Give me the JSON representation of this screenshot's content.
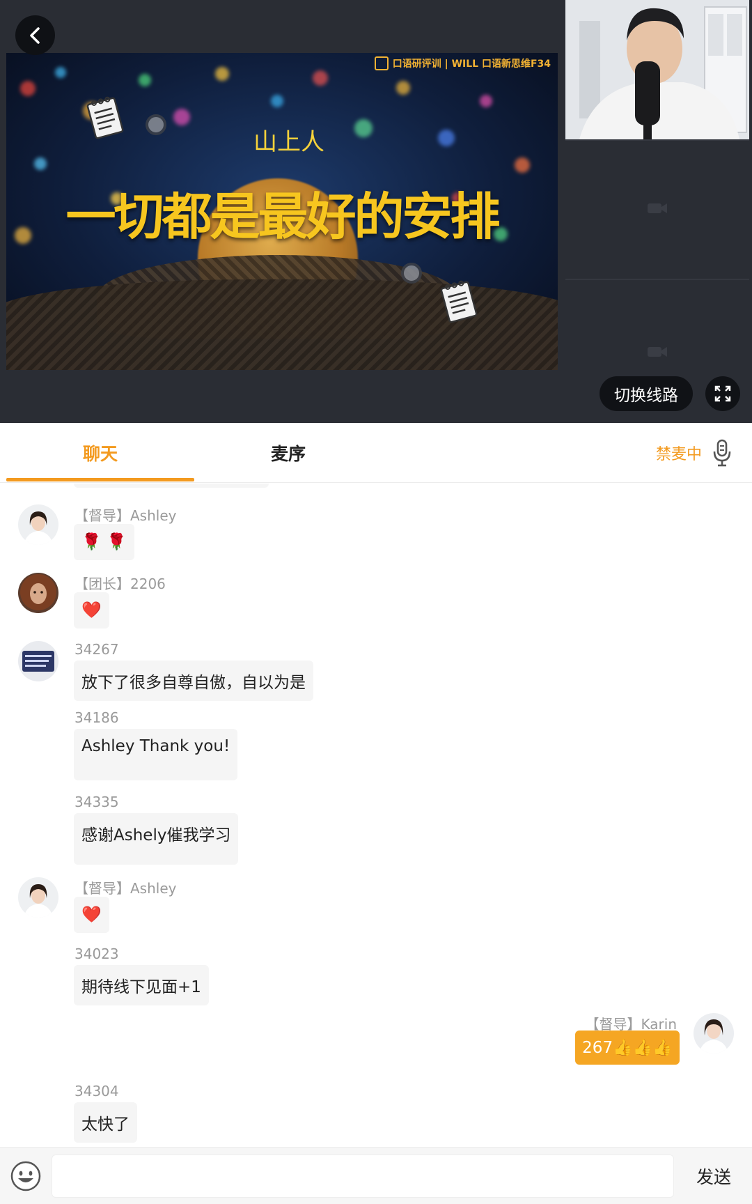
{
  "video": {
    "slide_logo_text": "口语研评训 | WILL 口语新思维F34",
    "slide_subtitle": "山上人",
    "slide_title": "一切都是最好的安排",
    "switch_line_label": "切换线路"
  },
  "tabs": {
    "chat_label": "聊天",
    "queue_label": "麦序",
    "mic_status_label": "禁麦中"
  },
  "chat": {
    "messages": [
      {
        "sender": "【督导】Ashley",
        "content": "🌹 🌹"
      },
      {
        "sender": "【团长】2206",
        "content": "❤️"
      },
      {
        "sender": "34267",
        "content": "放下了很多自尊自傲，自以为是"
      },
      {
        "sender": "34186",
        "content": "Ashley Thank you!"
      },
      {
        "sender": "34335",
        "content": "感谢Ashely催我学习"
      },
      {
        "sender": "【督导】Ashley",
        "content": "❤️"
      },
      {
        "sender": "34023",
        "content": "期待线下见面+1"
      },
      {
        "sender": "【督导】Karin",
        "content": "267👍👍👍"
      },
      {
        "sender": "34304",
        "content": "太快了"
      }
    ]
  },
  "input": {
    "placeholder": "",
    "send_label": "发送"
  },
  "colors": {
    "accent": "#f39a1f",
    "own_bubble": "#f5a623",
    "bubble": "#f5f5f5",
    "video_bg": "#2a2d34"
  },
  "icons": [
    "back-arrow-icon",
    "fullscreen-icon",
    "mic-off-icon",
    "camera-off-icon",
    "emoji-face-icon",
    "notepad-icon"
  ]
}
